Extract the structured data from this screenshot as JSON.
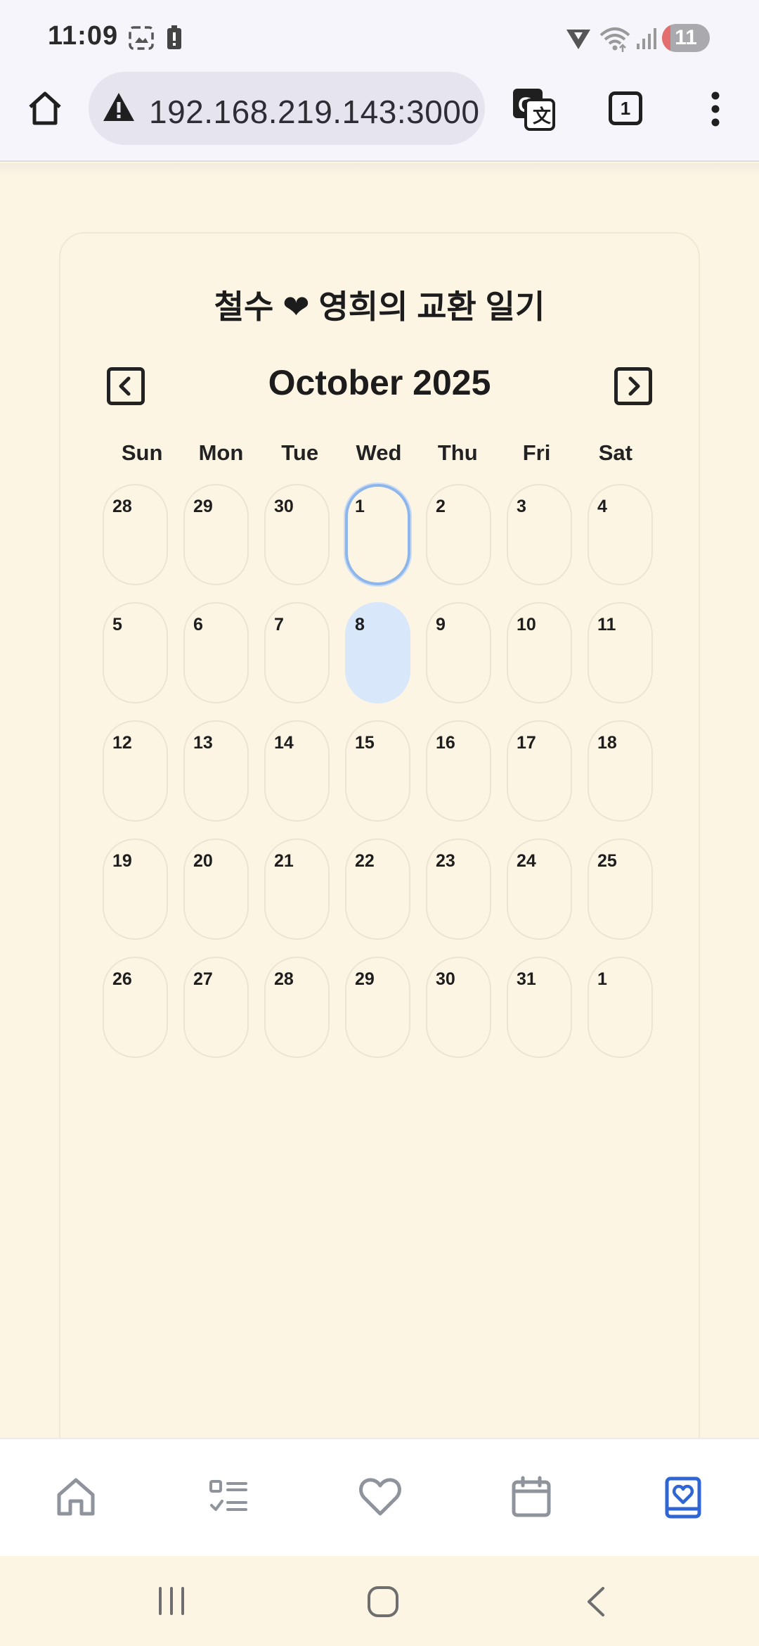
{
  "status_bar": {
    "time": "11:09",
    "notification_count": "11",
    "icons": [
      "screenshot-icon",
      "battery-alert-icon",
      "vpn-icon",
      "wifi-icon",
      "signal-icon"
    ]
  },
  "browser": {
    "url": "192.168.219.143:3000",
    "tab_count": "1",
    "icons": [
      "home-icon",
      "not-secure-warning-icon",
      "translate-icon",
      "tabs-icon",
      "more-menu-icon"
    ]
  },
  "diary": {
    "title": "철수 ❤ 영희의 교환 일기"
  },
  "calendar": {
    "month_label": "October 2025",
    "weekdays": [
      "Sun",
      "Mon",
      "Tue",
      "Wed",
      "Thu",
      "Fri",
      "Sat"
    ],
    "weeks": [
      [
        "28",
        "29",
        "30",
        "1",
        "2",
        "3",
        "4"
      ],
      [
        "5",
        "6",
        "7",
        "8",
        "9",
        "10",
        "11"
      ],
      [
        "12",
        "13",
        "14",
        "15",
        "16",
        "17",
        "18"
      ],
      [
        "19",
        "20",
        "21",
        "22",
        "23",
        "24",
        "25"
      ],
      [
        "26",
        "27",
        "28",
        "29",
        "30",
        "31",
        "1"
      ]
    ],
    "today": "1",
    "selected": "8"
  },
  "bottom_nav": {
    "items": [
      "home-icon",
      "checklist-icon",
      "heart-icon",
      "calendar-icon",
      "diary-book-icon"
    ],
    "active": "diary-book-icon",
    "colors": {
      "active": "#2f66d3",
      "inactive": "#8e939c"
    }
  }
}
